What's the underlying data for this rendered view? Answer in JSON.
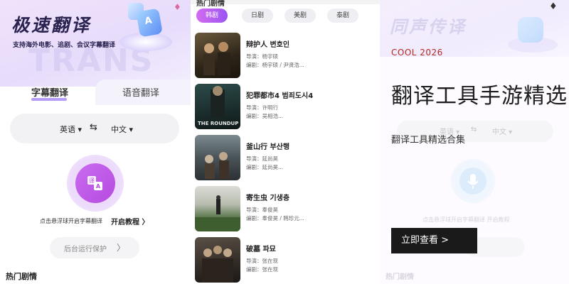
{
  "panel1": {
    "app_title": "极速翻译",
    "subtitle": "支持海外电影、追剧、会议字幕翻译",
    "watermark": "TRANS",
    "tabs": [
      {
        "label": "字幕翻译",
        "active": true
      },
      {
        "label": "语音翻译",
        "active": false
      }
    ],
    "language": {
      "source": "英语 ▾",
      "swap": "⇆",
      "target": "中文 ▾"
    },
    "float_icon_glyphs": {
      "a": "译",
      "b": "A"
    },
    "hint": "点击悬浮球开启字幕翻译",
    "tutorial_link": "开启教程 〉",
    "background_button": "后台运行保护",
    "background_button_arrow": "〉",
    "hot_section": "热门剧情",
    "icons": {
      "gem": "gem-icon",
      "swap": "swap-icon",
      "translate": "translate-icon"
    },
    "colors": {
      "accent": "#b64be0",
      "tab_underline": "#b49cf7",
      "title": "#2a2350"
    }
  },
  "panel2": {
    "cut_label": "热门剧情",
    "chips": [
      {
        "label": "韩剧",
        "active": true
      },
      {
        "label": "日剧",
        "active": false
      },
      {
        "label": "美剧",
        "active": false
      },
      {
        "label": "泰剧",
        "active": false
      }
    ],
    "movies": [
      {
        "title": "辩护人 변호인",
        "director": "导演：杨宇硕",
        "writer": "编剧：杨宇硕 / 尹贤浩...",
        "poster_text": ""
      },
      {
        "title": "犯罪都市4 범죄도시4",
        "director": "导演：许明行",
        "writer": "编剧：吴相浩...",
        "poster_text": "THE ROUNDUP"
      },
      {
        "title": "釜山行 부산행",
        "director": "导演：延尚昊",
        "writer": "编剧：延尚昊...",
        "poster_text": ""
      },
      {
        "title": "寄生虫 기생충",
        "director": "导演：奉俊昊",
        "writer": "编剧：奉俊昊 / 韩珍元...",
        "poster_text": ""
      },
      {
        "title": "破墓 파묘",
        "director": "导演：张在现",
        "writer": "编剧：张在现",
        "poster_text": ""
      }
    ],
    "colors": {
      "chip_active_start": "#d36bf0",
      "chip_active_end": "#9b55f2"
    }
  },
  "panel3": {
    "app_title": "同声传译",
    "language": {
      "source": "英语 ▾",
      "swap": "⇆",
      "target": "中文 ▾"
    },
    "hint": "点击悬浮球开启字幕翻译   开启教程",
    "hot_section": "热门剧情",
    "overlay": {
      "brand": "COOL 2026",
      "title": "翻译工具手游精选",
      "subtitle": "翻译工具精选合集",
      "cta": "立即查看 >"
    },
    "icons": {
      "gem": "gem-icon",
      "mic": "mic-icon"
    },
    "colors": {
      "brand": "#b5281e",
      "cta_bg": "#1a1a1a"
    }
  }
}
